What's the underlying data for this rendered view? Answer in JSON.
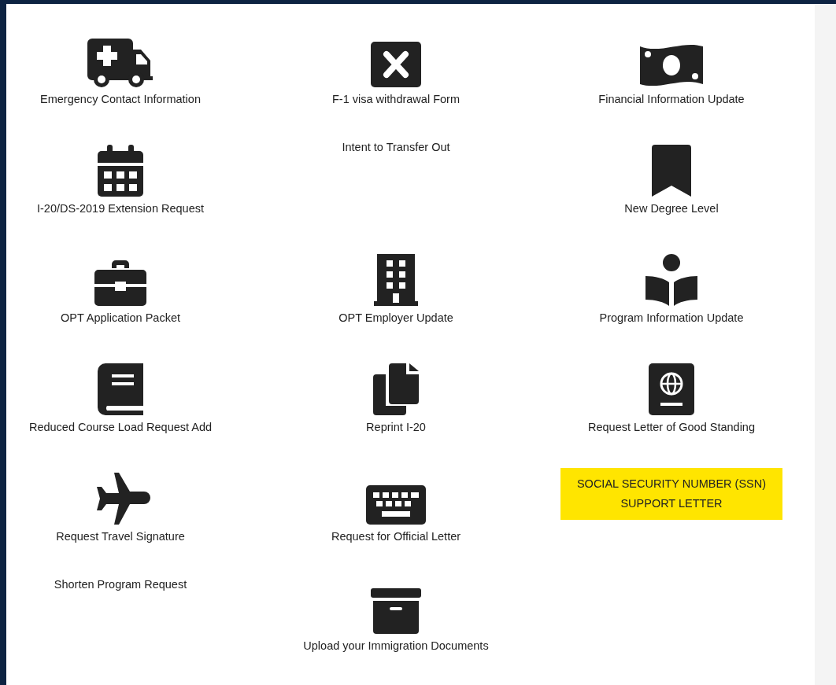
{
  "items": [
    {
      "label": "Emergency Contact Information",
      "highlighted": false
    },
    {
      "label": "F-1 visa withdrawal Form",
      "highlighted": false
    },
    {
      "label": "Financial Information Update",
      "highlighted": false
    },
    {
      "label": "I-20/DS-2019 Extension Request",
      "highlighted": false
    },
    {
      "label": "Intent to Transfer Out",
      "highlighted": false
    },
    {
      "label": "New Degree Level",
      "highlighted": false
    },
    {
      "label": "OPT Application Packet",
      "highlighted": false
    },
    {
      "label": "OPT Employer Update",
      "highlighted": false
    },
    {
      "label": "Program Information Update",
      "highlighted": false
    },
    {
      "label": "Reduced Course Load Request Add",
      "highlighted": false
    },
    {
      "label": "Reprint I-20",
      "highlighted": false
    },
    {
      "label": "Request Letter of Good Standing",
      "highlighted": false
    },
    {
      "label": "Request Travel Signature",
      "highlighted": false
    },
    {
      "label": "Request for Official Letter",
      "highlighted": false
    },
    {
      "label": "SOCIAL SECURITY NUMBER (SSN) SUPPORT LETTER",
      "highlighted": true
    },
    {
      "label": "Shorten Program Request",
      "highlighted": false
    },
    {
      "label": "Upload your Immigration Documents",
      "highlighted": false
    }
  ]
}
